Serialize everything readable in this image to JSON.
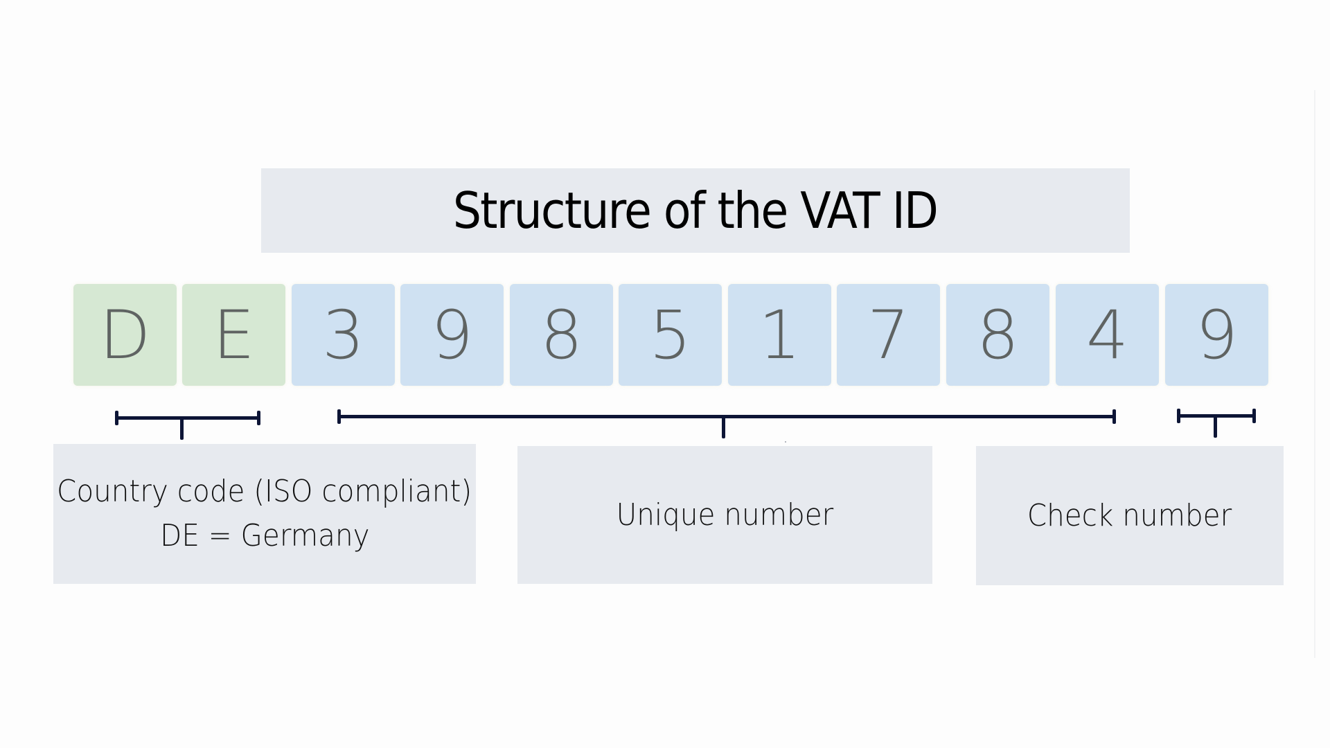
{
  "title": "Structure of the VAT ID",
  "vat_id": {
    "full": "DE398517849",
    "characters": [
      {
        "char": "D",
        "segment": "country"
      },
      {
        "char": "E",
        "segment": "country"
      },
      {
        "char": "3",
        "segment": "unique"
      },
      {
        "char": "9",
        "segment": "unique"
      },
      {
        "char": "8",
        "segment": "unique"
      },
      {
        "char": "5",
        "segment": "unique"
      },
      {
        "char": "1",
        "segment": "unique"
      },
      {
        "char": "7",
        "segment": "unique"
      },
      {
        "char": "8",
        "segment": "unique"
      },
      {
        "char": "4",
        "segment": "unique"
      },
      {
        "char": "9",
        "segment": "check"
      }
    ]
  },
  "segments": {
    "country": {
      "label_line1": "Country code (ISO compliant)",
      "label_line2": "DE = Germany",
      "color": "#d6e8d3"
    },
    "unique": {
      "label": "Unique number",
      "color": "#cfe1f2"
    },
    "check": {
      "label": "Check number",
      "color": "#cfe1f2"
    }
  },
  "colors": {
    "label_box": "#e7eaef",
    "bracket": "#0d1536",
    "char_text": "#5f6362"
  }
}
